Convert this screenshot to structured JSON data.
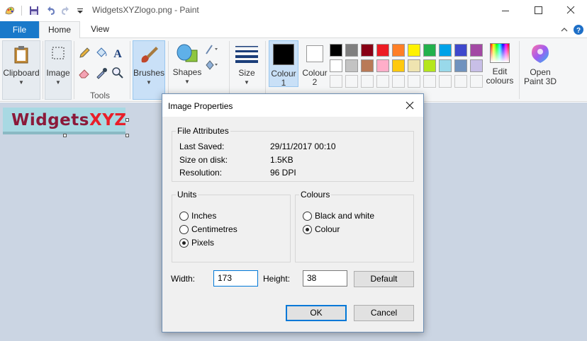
{
  "window": {
    "title": "WidgetsXYZlogo.png - Paint"
  },
  "tabs": {
    "file": "File",
    "home": "Home",
    "view": "View"
  },
  "ribbon": {
    "clipboard": "Clipboard",
    "image": "Image",
    "tools": "Tools",
    "brushes": "Brushes",
    "shapes": "Shapes",
    "size": "Size",
    "colour1_a": "Colour",
    "colour1_b": "1",
    "colour2_a": "Colour",
    "colour2_b": "2",
    "edit_colours_a": "Edit",
    "edit_colours_b": "colours",
    "open_paint3d_a": "Open",
    "open_paint3d_b": "Paint 3D",
    "palette_row1": [
      "#000000",
      "#7f7f7f",
      "#880015",
      "#ed1c24",
      "#ff7f27",
      "#fff200",
      "#22b14c",
      "#00a2e8",
      "#3f48cc",
      "#a349a4"
    ],
    "palette_row2": [
      "#ffffff",
      "#c3c3c3",
      "#b97a57",
      "#ffaec9",
      "#ffc90e",
      "#efe4b0",
      "#b5e61d",
      "#99d9ea",
      "#7092be",
      "#c8bfe7"
    ],
    "primary_colour": "#000000",
    "secondary_colour": "#ffffff"
  },
  "canvas": {
    "logo_part1": "Widgets",
    "logo_part2": "XYZ",
    "logo_bg": "#a8d9e3"
  },
  "dialog": {
    "title": "Image Properties",
    "file_attributes": {
      "legend": "File Attributes",
      "last_saved_label": "Last Saved:",
      "last_saved_value": "29/11/2017 00:10",
      "size_label": "Size on disk:",
      "size_value": "1.5KB",
      "resolution_label": "Resolution:",
      "resolution_value": "96 DPI"
    },
    "units": {
      "legend": "Units",
      "options": [
        "Inches",
        "Centimetres",
        "Pixels"
      ],
      "selected": "Pixels"
    },
    "colours": {
      "legend": "Colours",
      "options": [
        "Black and white",
        "Colour"
      ],
      "selected": "Colour"
    },
    "width_label": "Width:",
    "width_value": "173",
    "height_label": "Height:",
    "height_value": "38",
    "default_button": "Default",
    "ok_button": "OK",
    "cancel_button": "Cancel"
  }
}
